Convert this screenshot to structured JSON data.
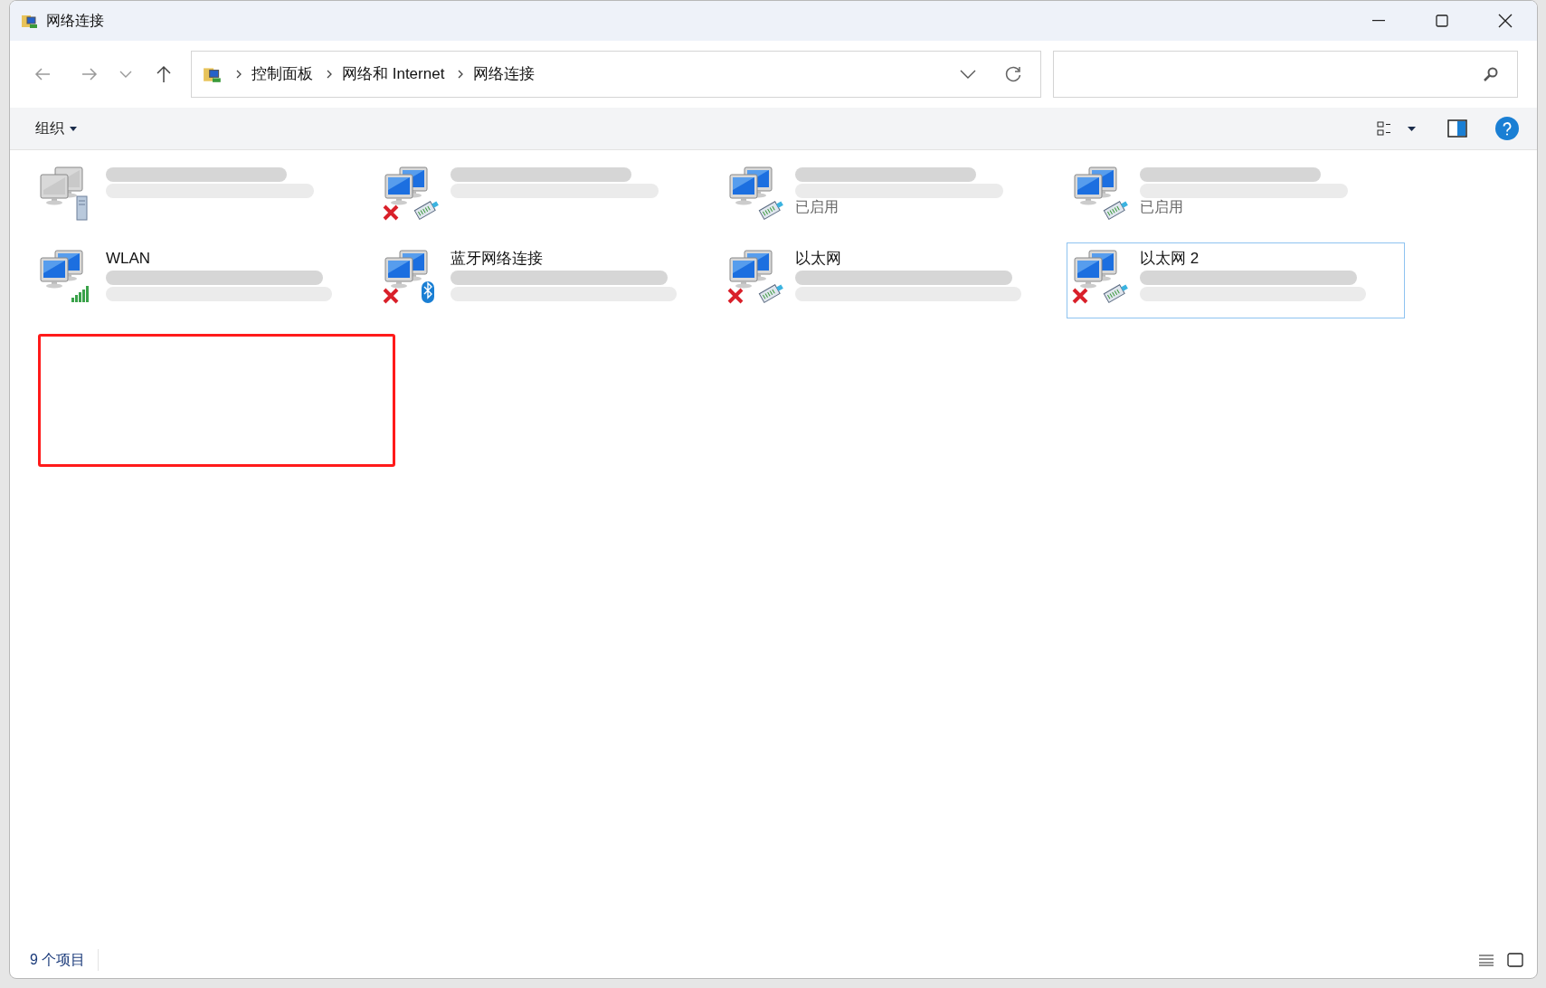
{
  "window": {
    "title": "网络连接"
  },
  "address": {
    "crumbs": [
      "控制面板",
      "网络和 Internet",
      "网络连接"
    ]
  },
  "toolbar": {
    "organize": "组织"
  },
  "items": [
    {
      "kind": "server",
      "disconnected": false,
      "selected": false
    },
    {
      "kind": "ethernet",
      "disconnected": true,
      "selected": false
    },
    {
      "status": "已启用",
      "kind": "ethernet",
      "disconnected": false,
      "selected": false
    },
    {
      "status": "已启用",
      "kind": "ethernet",
      "disconnected": false,
      "selected": false
    },
    {
      "name": "WLAN",
      "kind": "wifi",
      "disconnected": false,
      "selected": false
    },
    {
      "name": "蓝牙网络连接",
      "kind": "bluetooth",
      "disconnected": true,
      "selected": false
    },
    {
      "name": "以太网",
      "kind": "ethernet",
      "disconnected": true,
      "selected": false
    },
    {
      "name": "以太网 2",
      "kind": "ethernet",
      "disconnected": true,
      "selected": true
    }
  ],
  "status_bar": {
    "count": "9 个项目"
  }
}
